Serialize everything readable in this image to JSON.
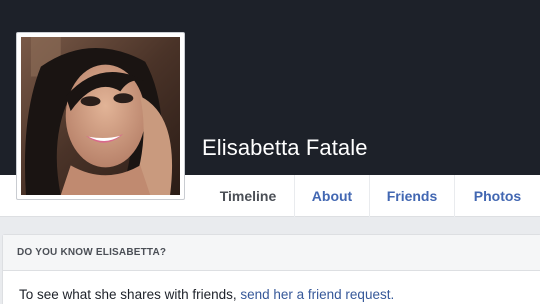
{
  "profile": {
    "name": "Elisabetta Fatale"
  },
  "tabs": [
    {
      "label": "Timeline"
    },
    {
      "label": "About"
    },
    {
      "label": "Friends"
    },
    {
      "label": "Photos"
    }
  ],
  "know_card": {
    "heading": "DO YOU KNOW ELISABETTA?",
    "text_before": "To see what she shares with friends, ",
    "link_text": "send her a friend request."
  },
  "colors": {
    "cover": "#1d2129",
    "link": "#4267b2",
    "page_background": "#e9ebee"
  }
}
